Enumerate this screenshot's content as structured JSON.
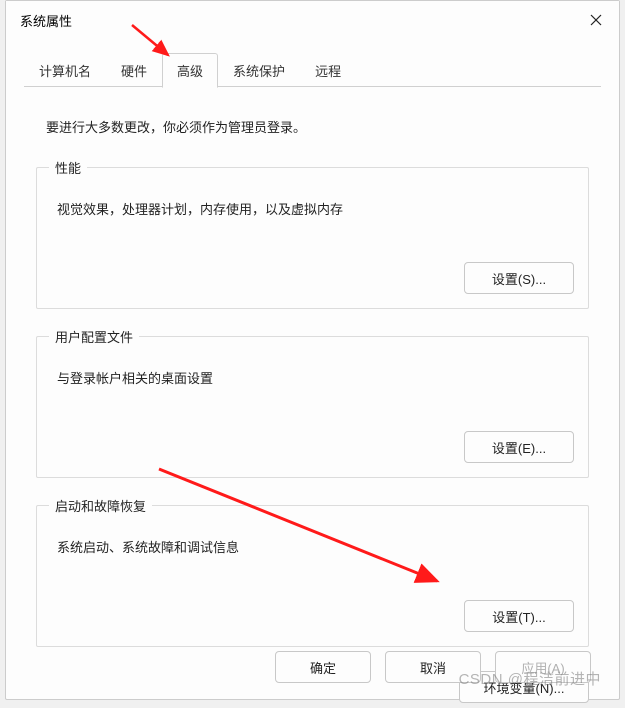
{
  "window": {
    "title": "系统属性"
  },
  "tabs": {
    "computer_name": "计算机名",
    "hardware": "硬件",
    "advanced": "高级",
    "system_protection": "系统保护",
    "remote": "远程"
  },
  "intro": "要进行大多数更改，你必须作为管理员登录。",
  "groups": {
    "performance": {
      "title": "性能",
      "desc": "视觉效果，处理器计划，内存使用，以及虚拟内存",
      "button": "设置(S)..."
    },
    "profiles": {
      "title": "用户配置文件",
      "desc": "与登录帐户相关的桌面设置",
      "button": "设置(E)..."
    },
    "startup": {
      "title": "启动和故障恢复",
      "desc": "系统启动、系统故障和调试信息",
      "button": "设置(T)..."
    }
  },
  "env_button": "环境变量(N)...",
  "dialog_buttons": {
    "ok": "确定",
    "cancel": "取消",
    "apply": "应用(A)"
  },
  "watermark": "CSDN @程洁前进中"
}
